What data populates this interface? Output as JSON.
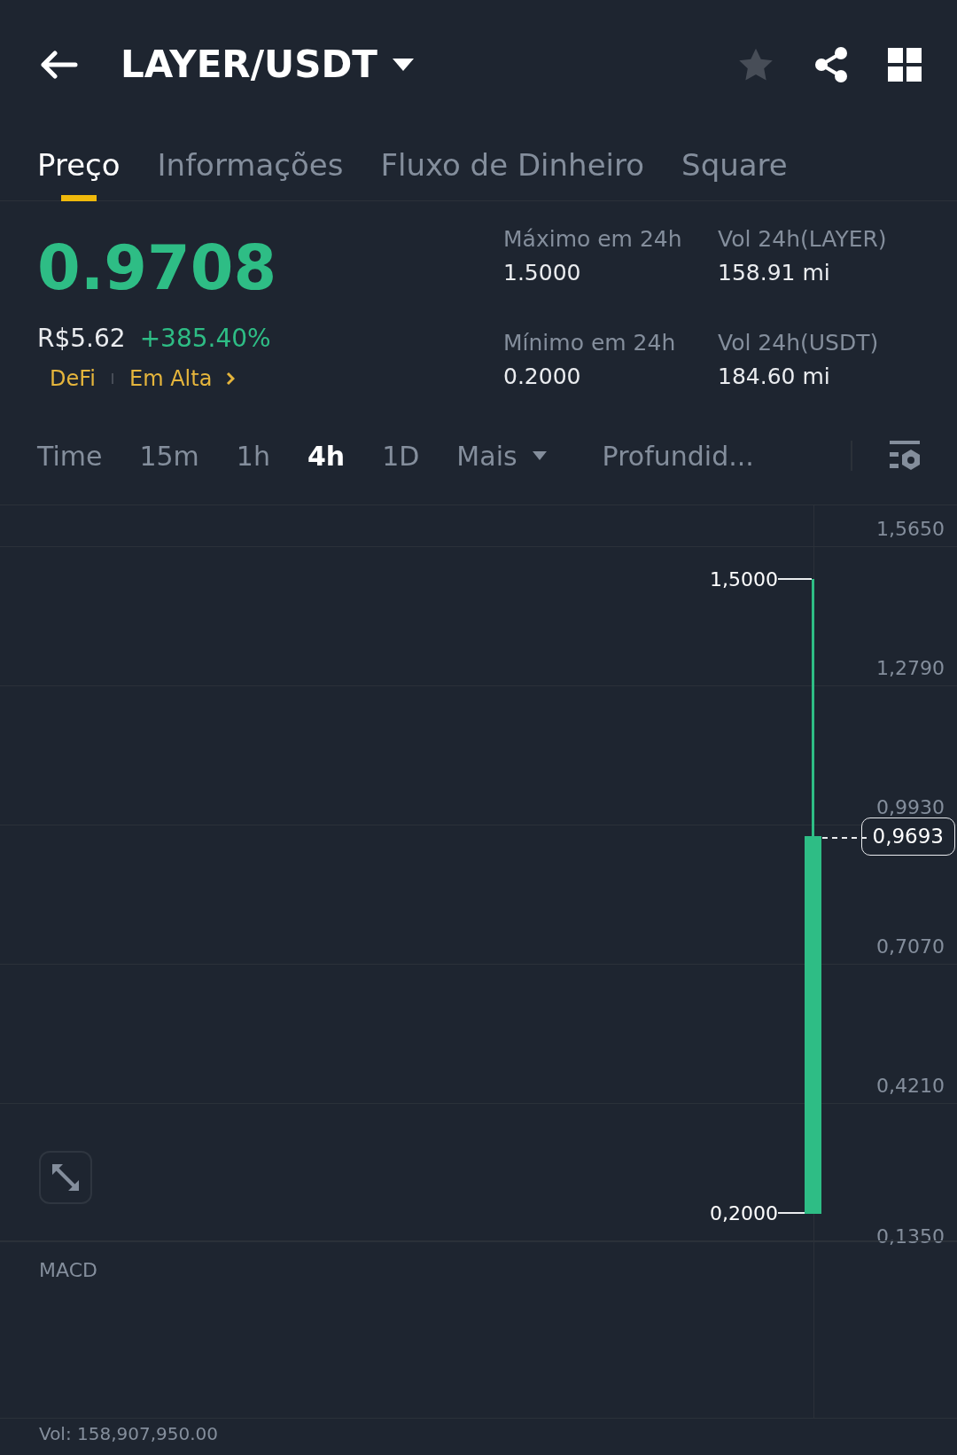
{
  "header": {
    "title": "LAYER/USDT",
    "favorite": false
  },
  "tabs": [
    {
      "label": "Preço",
      "selected": true
    },
    {
      "label": "Informações",
      "selected": false
    },
    {
      "label": "Fluxo de Dinheiro",
      "selected": false
    },
    {
      "label": "Square",
      "selected": false
    }
  ],
  "price": {
    "last": "0.9708",
    "fiat": "R$5.62",
    "change": "+385.40%",
    "tags": [
      "DeFi",
      "Em Alta"
    ]
  },
  "stats": [
    {
      "label": "Máximo em 24h",
      "value": "1.5000"
    },
    {
      "label": "Vol 24h(LAYER)",
      "value": "158.91 mi"
    },
    {
      "label": "Mínimo em 24h",
      "value": "0.2000"
    },
    {
      "label": "Vol 24h(USDT)",
      "value": "184.60 mi"
    }
  ],
  "intervals": [
    {
      "label": "Time",
      "selected": false,
      "kind": "plain"
    },
    {
      "label": "15m",
      "selected": false,
      "kind": "plain"
    },
    {
      "label": "1h",
      "selected": false,
      "kind": "plain"
    },
    {
      "label": "4h",
      "selected": true,
      "kind": "plain"
    },
    {
      "label": "1D",
      "selected": false,
      "kind": "plain"
    },
    {
      "label": "Mais",
      "selected": false,
      "kind": "dropdown"
    },
    {
      "label": "Profundid...",
      "selected": false,
      "kind": "plain"
    }
  ],
  "chart": {
    "y_axis_labels": [
      "1,5650",
      "1,2790",
      "0,9930",
      "0,7070",
      "0,4210",
      "0,1350"
    ],
    "high_label": "1,5000",
    "low_label": "0,2000",
    "last_price_tag": "0,9693"
  },
  "indicator": {
    "label": "MACD"
  },
  "volume": {
    "label": "Vol: 158,907,950.00"
  }
}
